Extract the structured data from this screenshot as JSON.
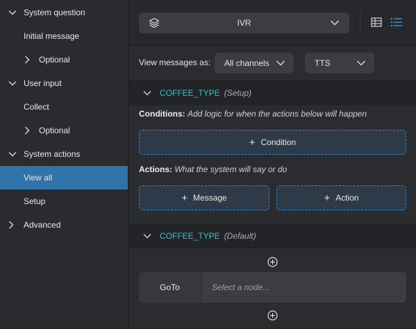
{
  "sidebar": {
    "items": [
      {
        "label": "System question",
        "chevron": "down"
      },
      {
        "label": "Initial message",
        "chevron": "none"
      },
      {
        "label": "Optional",
        "chevron": "right"
      },
      {
        "label": "User input",
        "chevron": "down"
      },
      {
        "label": "Collect",
        "chevron": "none"
      },
      {
        "label": "Optional",
        "chevron": "right"
      },
      {
        "label": "System actions",
        "chevron": "down"
      },
      {
        "label": "View all",
        "chevron": "none",
        "active": true
      },
      {
        "label": "Setup",
        "chevron": "none"
      },
      {
        "label": "Advanced",
        "chevron": "right"
      }
    ]
  },
  "topbar": {
    "channel_value": "IVR",
    "channel_icon": "layers-icon",
    "view_icons": [
      "table-icon",
      "list-icon"
    ],
    "active_view": "list"
  },
  "viewbar": {
    "label": "View messages as:",
    "channels_value": "All channels",
    "voice_value": "TTS"
  },
  "setup_section": {
    "name": "COFFEE_TYPE",
    "tag": "(Setup)",
    "conditions_title": "Conditions:",
    "conditions_hint": "Add logic for when the actions below will happen",
    "condition_button": "Condition",
    "actions_title": "Actions:",
    "actions_hint": "What the system will say or do",
    "message_button": "Message",
    "action_button": "Action"
  },
  "default_section": {
    "name": "COFFEE_TYPE",
    "tag": "(Default)",
    "goto_label": "GoTo",
    "goto_placeholder": "Select a node..."
  },
  "colors": {
    "accent": "#2f73a8",
    "teal": "#2fc4c8",
    "dashed_border": "#3b86c6"
  }
}
